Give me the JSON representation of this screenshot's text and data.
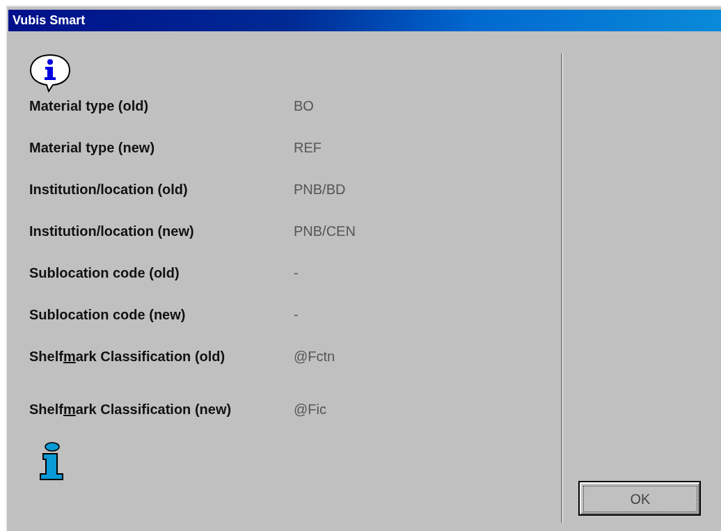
{
  "window": {
    "title": "Vubis Smart"
  },
  "rows": [
    {
      "label": "Material type (old)",
      "value": "BO"
    },
    {
      "label": "Material type (new)",
      "value": "REF"
    },
    {
      "label": "Institution/location (old)",
      "value": "PNB/BD"
    },
    {
      "label": "Institution/location (new)",
      "value": "PNB/CEN"
    },
    {
      "label": "Sublocation code (old)",
      "value": "-"
    },
    {
      "label": "Sublocation code (new)",
      "value": "-"
    },
    {
      "label_before": "Shelf",
      "label_key": "m",
      "label_after": "ark Classification (old)",
      "value": "@Fctn"
    },
    {
      "label_before": "Shelf",
      "label_key": "m",
      "label_after": "ark Classification (new)",
      "value": "@Fic"
    }
  ],
  "buttons": [
    {
      "label": "OK",
      "focused": true
    }
  ]
}
